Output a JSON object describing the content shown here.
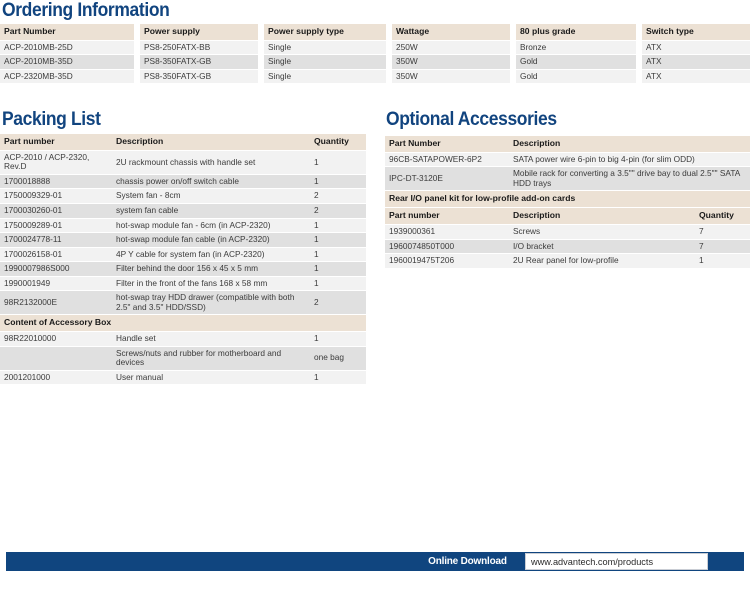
{
  "sections": {
    "ordering": {
      "title": "Ordering Information"
    },
    "packing": {
      "title": "Packing List"
    },
    "accessories": {
      "title": "Optional Accessories"
    }
  },
  "ordering_table": {
    "headers": [
      "Part Number",
      "Power supply",
      "Power supply type",
      "Wattage",
      "80 plus grade",
      "Switch type"
    ],
    "rows": [
      [
        "ACP-2010MB-25D",
        "PS8-250FATX-BB",
        "Single",
        "250W",
        "Bronze",
        "ATX"
      ],
      [
        "ACP-2010MB-35D",
        "PS8-350FATX-GB",
        "Single",
        "350W",
        "Gold",
        "ATX"
      ],
      [
        "ACP-2320MB-35D",
        "PS8-350FATX-GB",
        "Single",
        "350W",
        "Gold",
        "ATX"
      ]
    ]
  },
  "packing_table": {
    "headers": [
      "Part number",
      "Description",
      "Quantity"
    ],
    "rows": [
      [
        "ACP-2010 / ACP-2320, Rev.D",
        "2U rackmount chassis with handle set",
        "1"
      ],
      [
        "1700018888",
        "chassis power on/off switch cable",
        "1"
      ],
      [
        "1750009329-01",
        "System fan - 8cm",
        "2"
      ],
      [
        "1700030260-01",
        "system fan cable",
        "2"
      ],
      [
        "1750009289-01",
        "hot-swap module fan - 6cm (in ACP-2320)",
        "1"
      ],
      [
        "1700024778-11",
        "hot-swap module fan cable (in ACP-2320)",
        "1"
      ],
      [
        "1700026158-01",
        "4P Y cable for system fan (in ACP-2320)",
        "1"
      ],
      [
        "1990007986S000",
        "Filter behind the door 156 x 45 x 5 mm",
        "1"
      ],
      [
        "1990001949",
        "Filter in the front of the fans 168 x 58 mm",
        "1"
      ],
      [
        "98R2132000E",
        "hot-swap tray HDD drawer (compatible with both 2.5\" and 3.5\" HDD/SSD)",
        "2"
      ]
    ],
    "subheading": "Content of Accessory Box",
    "accessory_rows": [
      [
        "98R22010000",
        "Handle set",
        "1"
      ],
      [
        "",
        "Screws/nuts and rubber for motherboard and devices",
        "one bag"
      ],
      [
        "2001201000",
        "User manual",
        "1"
      ]
    ]
  },
  "accessories_table": {
    "headers": [
      "Part Number",
      "Description"
    ],
    "rows": [
      [
        "96CB-SATAPOWER-6P2",
        "SATA power wire 6-pin to big 4-pin (for slim ODD)"
      ],
      [
        "IPC-DT-3120E",
        "Mobile rack for converting a 3.5\"\" drive bay to dual 2.5\"\" SATA HDD trays"
      ]
    ],
    "subheading": "Rear I/O panel kit for low-profile add-on cards",
    "sub_headers": [
      "Part number",
      "Description",
      "Quantity"
    ],
    "sub_rows": [
      [
        "1939000361",
        "Screws",
        "7"
      ],
      [
        "1960074850T000",
        "I/O bracket",
        "7"
      ],
      [
        "1960019475T206",
        "2U Rear panel for low-profile",
        "1"
      ]
    ]
  },
  "footer": {
    "label": "Online Download",
    "url": "www.advantech.com/products"
  },
  "colors": {
    "title_blue": "#11447f",
    "footer_blue": "#10457f",
    "header_beige": "#ece1d4",
    "row_light": "#f2f2f2",
    "row_dark": "#e0e0e0"
  }
}
